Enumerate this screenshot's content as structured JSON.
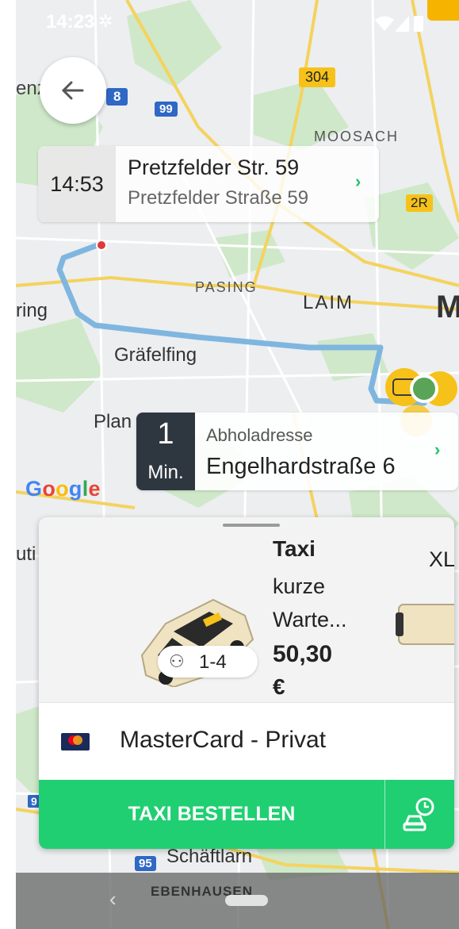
{
  "status_bar": {
    "time": "14:23"
  },
  "map": {
    "labels": {
      "enz": "enz",
      "moosach": "MOOSACH",
      "pasing": "PASING",
      "laim": "LAIM",
      "m": "M",
      "ring": "ring",
      "graefelfing": "Gräfelfing",
      "plan": "Plan",
      "uti": "uti",
      "schaeftlarn": "Schäftlarn",
      "ebenhausen": "EBENHAUSEN"
    },
    "road_badges": {
      "r304": "304",
      "r8": "8",
      "r99": "99",
      "r2r": "2R",
      "r95": "95",
      "r9": "9"
    },
    "google": [
      "G",
      "o",
      "o",
      "g",
      "l",
      "e"
    ]
  },
  "destination": {
    "time": "14:53",
    "title": "Pretzfelder Str. 59",
    "subtitle": "Pretzfelder Straße 59"
  },
  "pickup": {
    "eta_value": "1",
    "eta_unit": "Min.",
    "label": "Abholadresse",
    "address": "Engelhardstraße 6"
  },
  "vehicle": {
    "name": "Taxi",
    "desc_line1": "kurze",
    "desc_line2": "Warte...",
    "price": "50,30",
    "currency": "€",
    "capacity": "1-4",
    "next_name": "XL"
  },
  "payment": {
    "label": "MasterCard - Privat"
  },
  "order": {
    "button_label": "TAXI BESTELLEN"
  },
  "colors": {
    "accent_green": "#20cf72",
    "route_blue": "#7fb6df",
    "eta_dark": "#2e3640",
    "taxi_yellow": "#f6c21a"
  },
  "icons": {
    "back": "arrow-left-icon",
    "chevron": "chevron-right-icon",
    "capacity": "people-icon",
    "card": "mastercard-icon",
    "schedule": "car-clock-icon"
  }
}
